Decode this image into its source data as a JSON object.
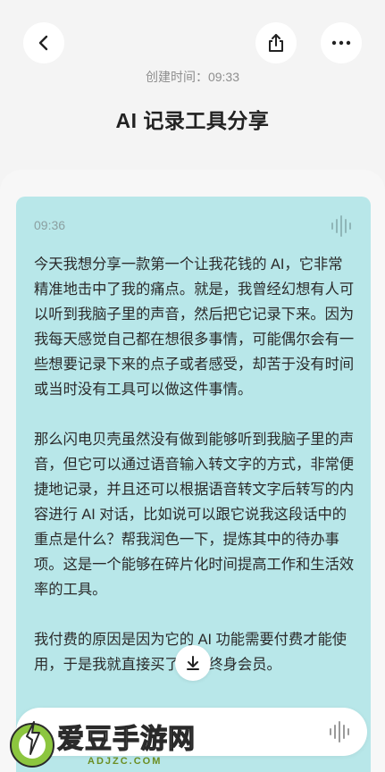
{
  "header": {
    "back_icon": "chevron-left-icon",
    "share_icon": "share-icon",
    "more_icon": "more-horizontal-icon"
  },
  "created_label": "创建时间：09:33",
  "title": "AI 记录工具分享",
  "card": {
    "time": "09:36",
    "paragraphs": [
      "今天我想分享一款第一个让我花钱的 AI，它非常精准地击中了我的痛点。就是，我曾经幻想有人可以听到我脑子里的声音，然后把它记录下来。因为我每天感觉自己都在想很多事情，可能偶尔会有一些想要记录下来的点子或者感受，却苦于没有时间或当时没有工具可以做这件事情。",
      "那么闪电贝壳虽然没有做到能够听到我脑子里的声音，但它可以通过语音输入转文字的方式，非常便捷地记录，并且还可以根据语音转文字后转写的内容进行 AI 对话，比如说可以跟它说我这段话中的重点是什么？帮我润色一下，提炼其中的待办事项。这是一个能够在碎片化时间提高工作和生活效率的工具。",
      "我付费的原因是因为它的 AI 功能需要付费才能使用，于是我就直接买了一个终身会员。"
    ]
  },
  "watermark": {
    "text": "爱豆手游网",
    "sub": "ADJZC.COM"
  },
  "colors": {
    "card": "#b8e7e9",
    "background": "#f4f4f4"
  }
}
